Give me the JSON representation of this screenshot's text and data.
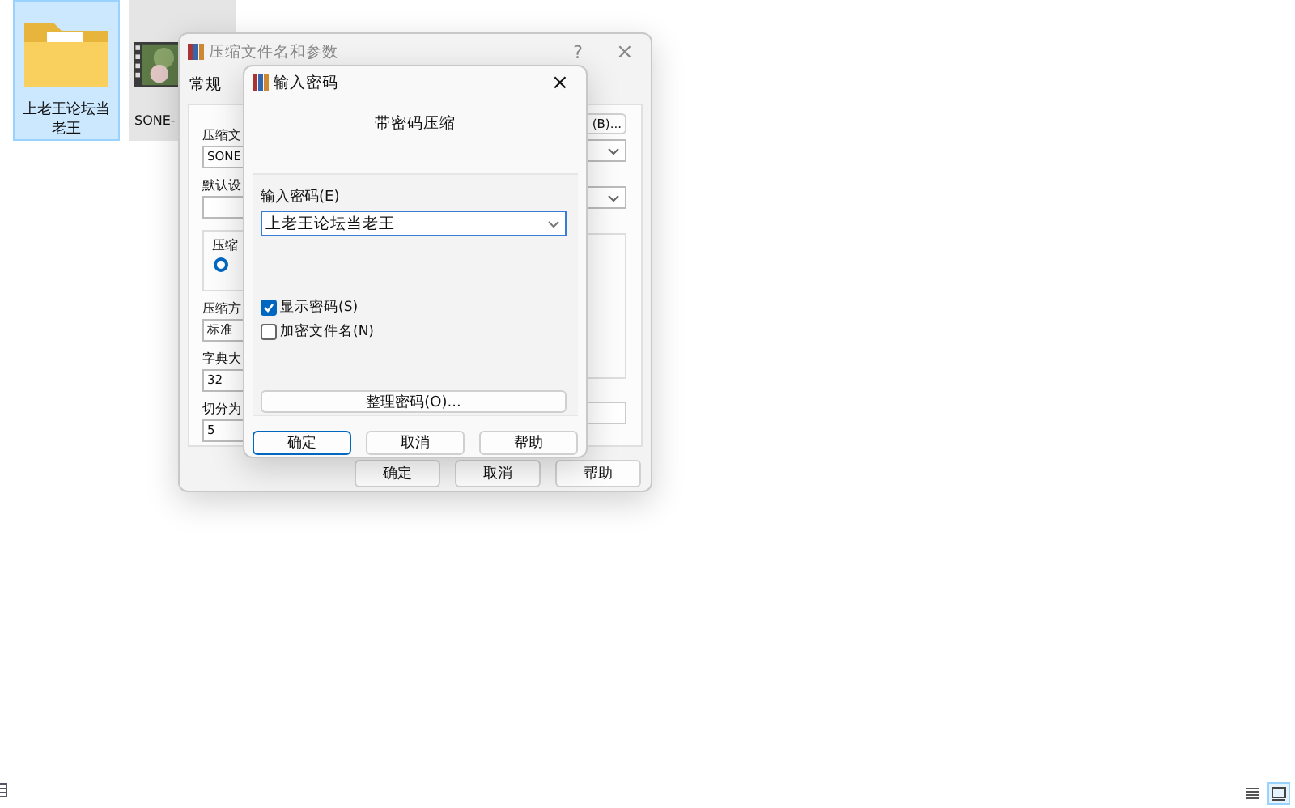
{
  "desktop_items": [
    {
      "kind": "folder",
      "label": "上老王论坛当老王",
      "selected": true
    },
    {
      "kind": "video",
      "label": "SONE-",
      "selected": false
    }
  ],
  "back_dialog": {
    "title": "压缩文件名和参数",
    "help": "?",
    "close": "×",
    "tab": "常规",
    "left": [
      {
        "kind": "label",
        "text": "压缩文"
      },
      {
        "kind": "field",
        "text": "SONE"
      },
      {
        "kind": "label",
        "text": "默认设"
      },
      {
        "kind": "field"
      },
      {
        "kind": "group",
        "text": "压缩",
        "checked": true
      },
      {
        "kind": "label",
        "text": "压缩方"
      },
      {
        "kind": "field",
        "text": "标准"
      },
      {
        "kind": "label",
        "text": "字典大"
      },
      {
        "kind": "field",
        "text": "32"
      },
      {
        "kind": "label",
        "text": "切分为"
      },
      {
        "kind": "field",
        "text": "5"
      }
    ],
    "browse": "(B)...",
    "buttons": [
      "确定",
      "取消",
      "帮助"
    ]
  },
  "password_dialog": {
    "title": "输入密码",
    "close": "×",
    "heading": "带密码压缩",
    "label": "输入密码(E)",
    "value": "上老王论坛当老王",
    "options": [
      {
        "label": "显示密码(S)",
        "checked": true
      },
      {
        "label": "加密文件名(N)",
        "checked": false
      }
    ],
    "organize": "整理密码(O)...",
    "buttons": [
      {
        "label": "确定",
        "default": true
      },
      {
        "label": "取消",
        "default": false
      },
      {
        "label": "帮助",
        "default": false
      }
    ]
  },
  "view_buttons": [
    {
      "kind": "list",
      "selected": false
    },
    {
      "kind": "details",
      "selected": true
    }
  ]
}
